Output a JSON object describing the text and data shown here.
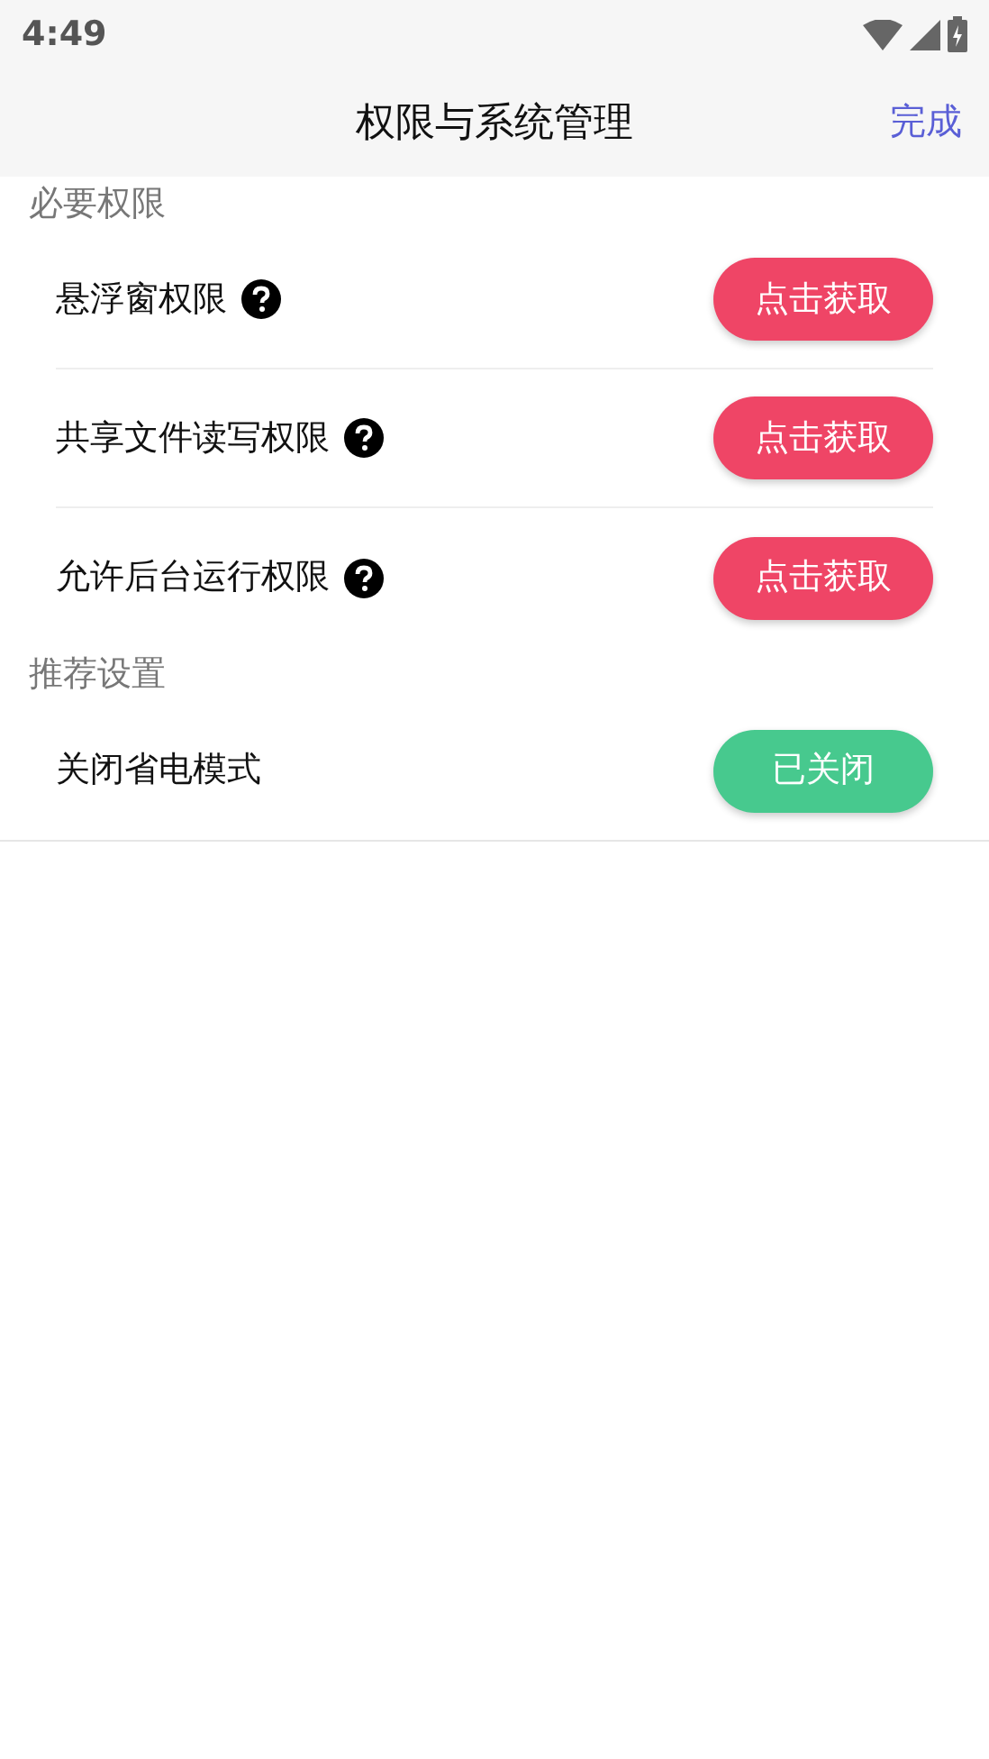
{
  "status_bar": {
    "time": "4:49"
  },
  "header": {
    "title": "权限与系统管理",
    "action": "完成"
  },
  "sections": [
    {
      "title": "必要权限",
      "items": [
        {
          "label": "悬浮窗权限",
          "help": true,
          "button": "点击获取",
          "done": false
        },
        {
          "label": "共享文件读写权限",
          "help": true,
          "button": "点击获取",
          "done": false
        },
        {
          "label": "允许后台运行权限",
          "help": true,
          "button": "点击获取",
          "done": false
        }
      ]
    },
    {
      "title": "推荐设置",
      "items": [
        {
          "label": "关闭省电模式",
          "help": false,
          "button": "已关闭",
          "done": true
        }
      ]
    }
  ]
}
